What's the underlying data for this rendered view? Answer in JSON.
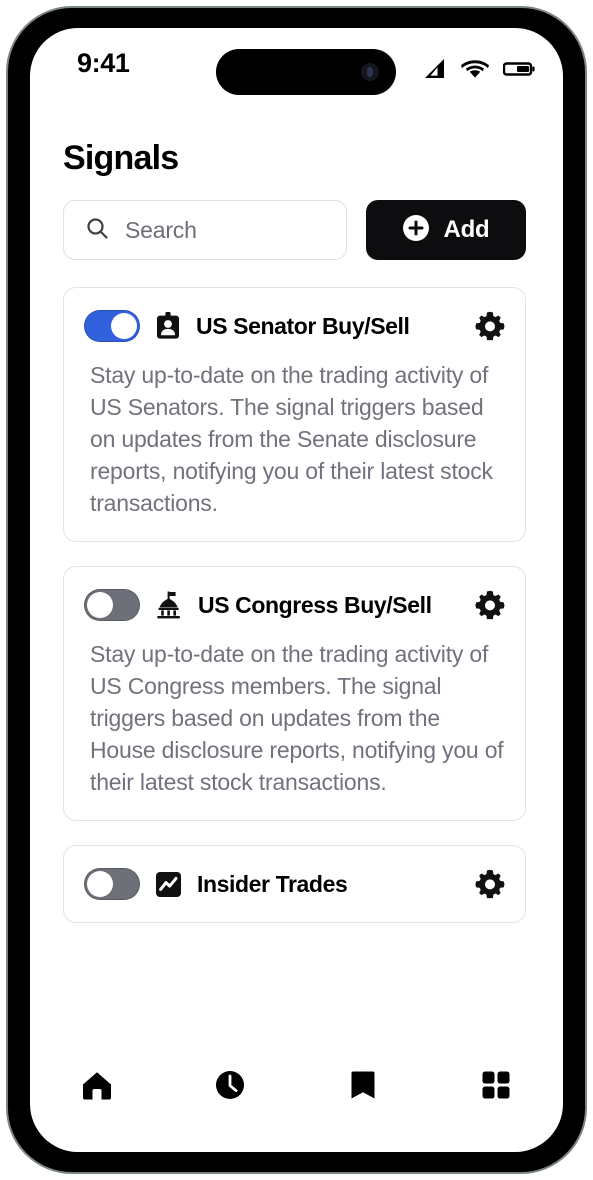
{
  "status_bar": {
    "time": "9:41",
    "icons": [
      "cellular-signal-icon",
      "wifi-icon",
      "battery-icon"
    ]
  },
  "header": {
    "title": "Signals"
  },
  "search": {
    "placeholder": "Search",
    "icon": "search-icon",
    "value": ""
  },
  "add_button": {
    "label": "Add",
    "icon": "plus-circle-icon"
  },
  "cards": [
    {
      "title": "US Senator Buy/Sell",
      "icon": "id-badge-icon",
      "toggle_state": "on",
      "settings_icon": "gear-icon",
      "description": "Stay up-to-date on the trading activity of US Senators. The signal triggers based on updates from the Senate disclosure reports, notifying you of their latest stock transactions."
    },
    {
      "title": "US Congress Buy/Sell",
      "icon": "capitol-building-icon",
      "toggle_state": "off",
      "settings_icon": "gear-icon",
      "description": "Stay up-to-date on the trading activity of US Congress members. The signal triggers based on updates from the House disclosure reports, notifying you of their latest stock transactions."
    },
    {
      "title": "Insider Trades",
      "icon": "trend-chart-icon",
      "toggle_state": "off",
      "settings_icon": "gear-icon",
      "description": ""
    }
  ],
  "bottom_nav": [
    {
      "name": "home",
      "icon": "home-icon"
    },
    {
      "name": "history",
      "icon": "clock-icon"
    },
    {
      "name": "bookmarks",
      "icon": "bookmark-icon"
    },
    {
      "name": "more",
      "icon": "grid-icon"
    }
  ],
  "colors": {
    "toggle_on": "#3261dd",
    "toggle_off": "#6d7078",
    "accent_dark": "#0d0d0f",
    "card_border": "#e3e3e6",
    "muted_text": "#70737c"
  }
}
